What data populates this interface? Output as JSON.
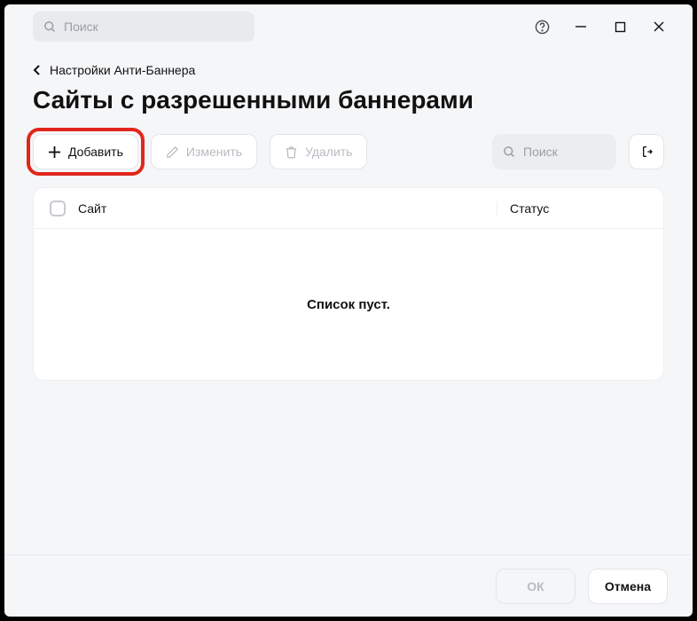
{
  "titlebar": {
    "search_placeholder": "Поиск"
  },
  "breadcrumb": {
    "text": "Настройки Анти-Баннера"
  },
  "page": {
    "title": "Сайты с разрешенными баннерами"
  },
  "toolbar": {
    "add_label": "Добавить",
    "edit_label": "Изменить",
    "delete_label": "Удалить",
    "search_placeholder": "Поиск"
  },
  "table": {
    "col_site": "Сайт",
    "col_status": "Статус",
    "empty_text": "Список пуст."
  },
  "footer": {
    "ok_label": "ОК",
    "cancel_label": "Отмена"
  }
}
